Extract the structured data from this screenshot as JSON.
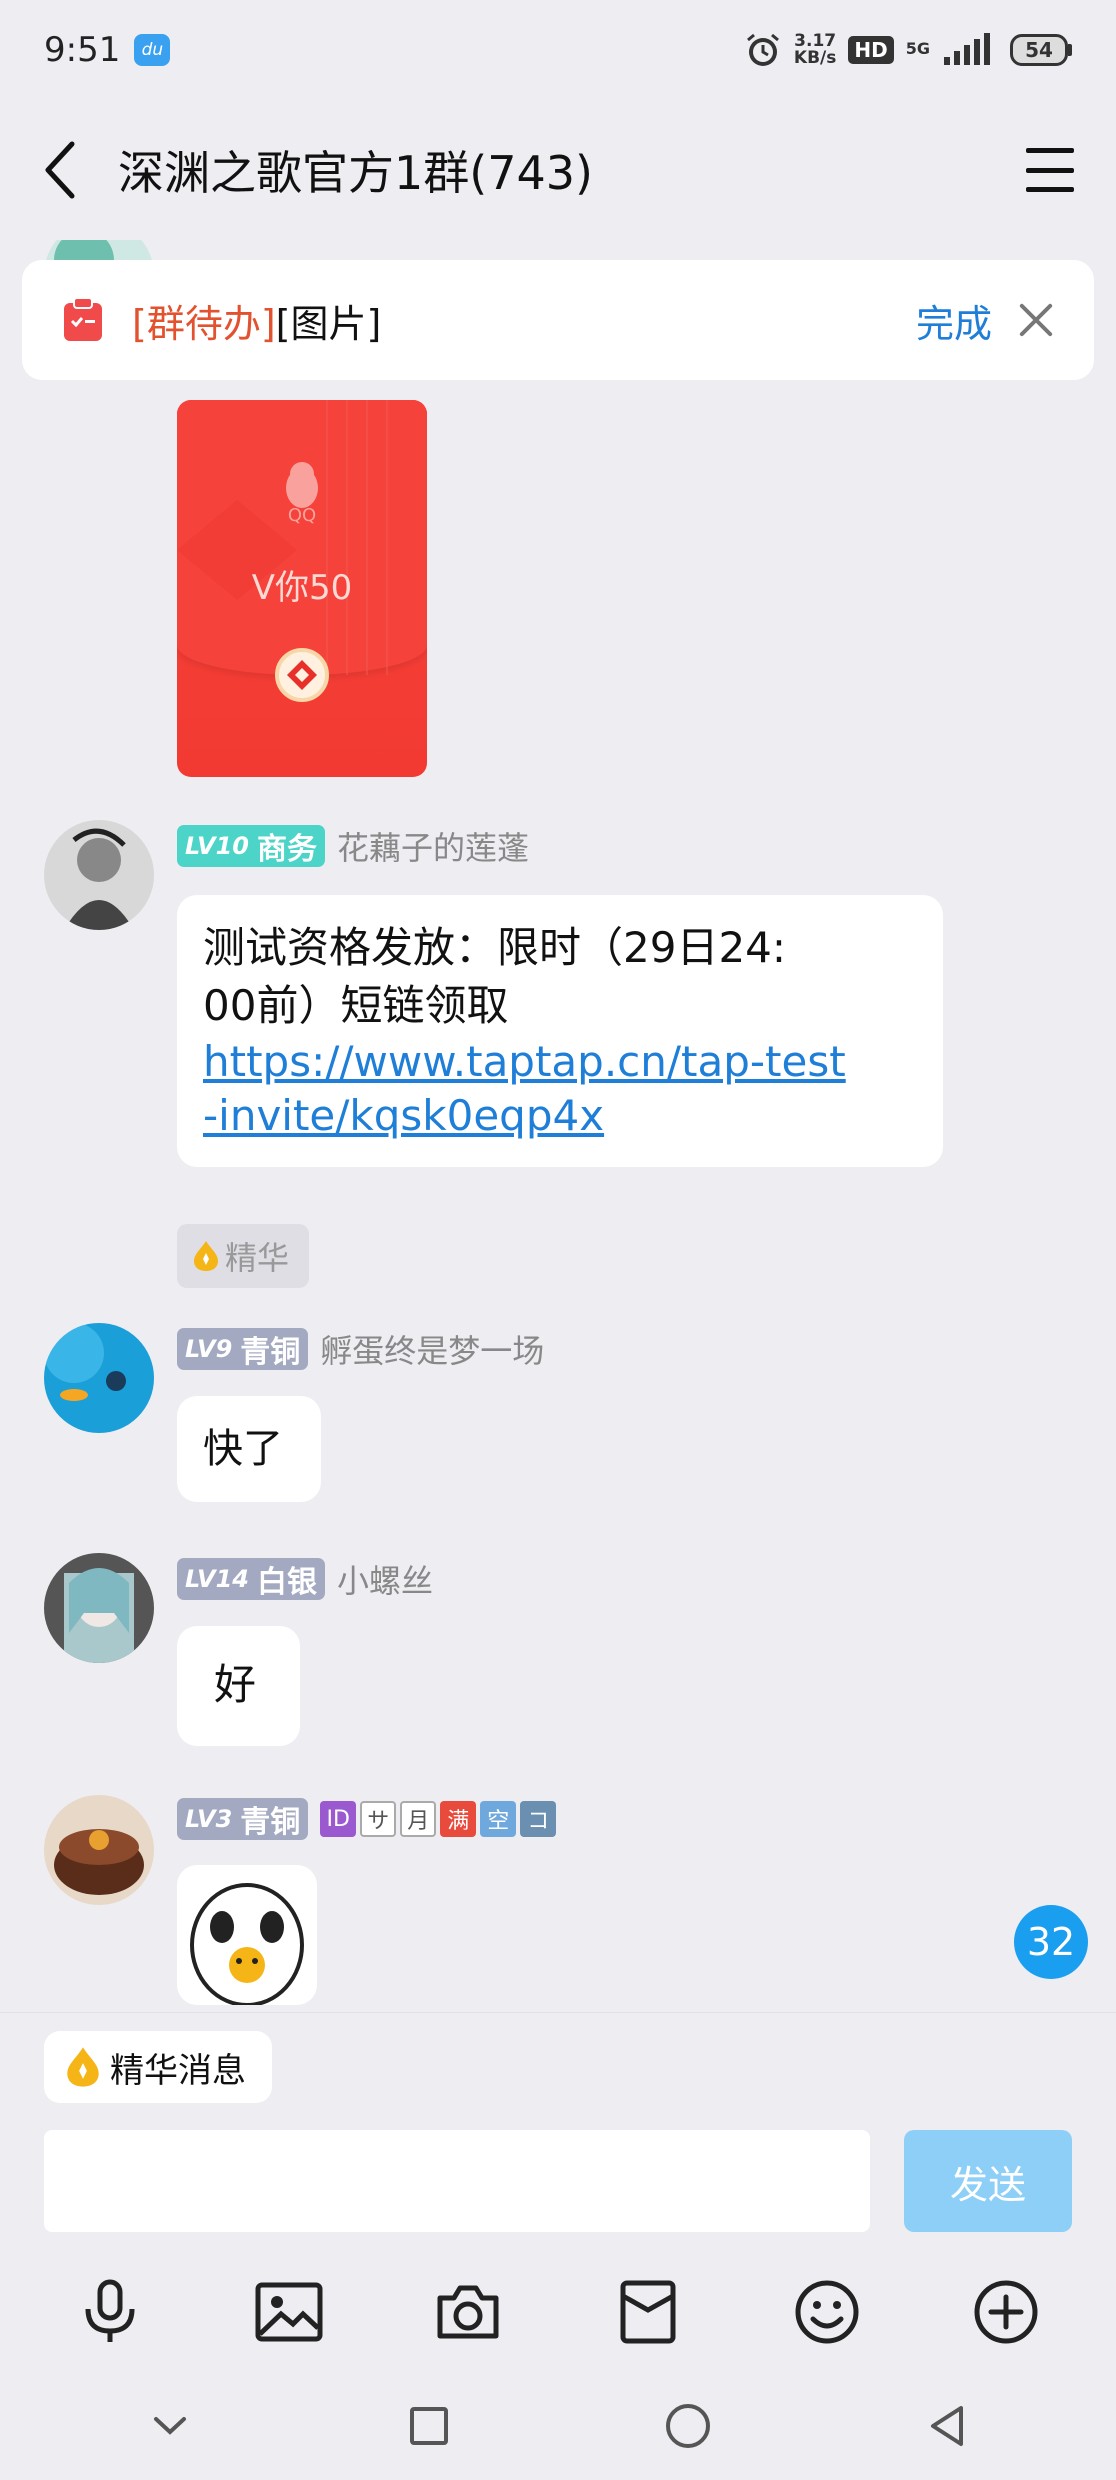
{
  "status_bar": {
    "time": "9:51",
    "app_badge": "du",
    "net_speed_value": "3.17",
    "net_speed_unit": "KB/s",
    "hd": "HD",
    "network": "5G",
    "battery": "54"
  },
  "header": {
    "title": "深渊之歌官方1群(743)"
  },
  "todo_banner": {
    "tag": "[群待办]",
    "content": "[图片]",
    "done_label": "完成"
  },
  "messages": {
    "redpacket": {
      "brand": "QQ",
      "title": "V你50"
    },
    "m1": {
      "level": "LV10",
      "level_title": "商务",
      "nickname": "花藕子的莲蓬",
      "text_line1": "测试资格发放：限时（29日24:",
      "text_line2": "00前）短链领取",
      "link": "https://www.taptap.cn/tap-test-invite/kqsk0eqp4x",
      "link_line1": "https://www.taptap.cn/tap-test",
      "link_line2": "-invite/kqsk0eqp4x",
      "essence_tag": "精华"
    },
    "m2": {
      "level": "LV9",
      "level_title": "青铜",
      "nickname": "孵蛋终是梦一场",
      "text": "快了"
    },
    "m3": {
      "level": "LV14",
      "level_title": "白银",
      "nickname": "小螺丝",
      "text": "好"
    },
    "m4": {
      "level": "LV3",
      "level_title": "青铜",
      "medals": [
        {
          "label": "ID",
          "color": "#9b59d0"
        },
        {
          "label": "サ",
          "color": "#c8c8d0"
        },
        {
          "label": "月",
          "color": "#c8c8d0"
        },
        {
          "label": "满",
          "color": "#e84a3c"
        },
        {
          "label": "空",
          "color": "#6fa8dc"
        },
        {
          "label": "コ",
          "color": "#6a8fb0"
        }
      ]
    }
  },
  "unread_count": "32",
  "essence_bar": {
    "label": "精华消息"
  },
  "composer": {
    "placeholder": "",
    "send_label": "发送"
  },
  "colors": {
    "accent": "#1e7ed8",
    "todo_tag": "#e2522f",
    "redpacket": "#f5423b",
    "level_teal": "#4cd4c8",
    "level_gray": "#a4a9c2",
    "send_disabled": "#8ecff8"
  }
}
